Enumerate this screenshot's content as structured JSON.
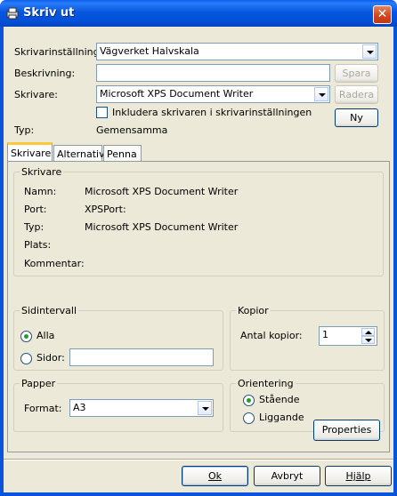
{
  "window": {
    "title": "Skriv ut",
    "close_glyph": "✕"
  },
  "top": {
    "setting_label": "Skrivarinställning:",
    "setting_value": "Vägverket Halvskala",
    "description_label": "Beskrivning:",
    "description_value": "",
    "printer_label": "Skrivare:",
    "printer_value": "Microsoft XPS Document Writer",
    "include_checkbox_label": "Inkludera skrivaren i skrivarinställningen",
    "type_label": "Typ:",
    "type_value": "Gemensamma",
    "save_button": "Spara",
    "delete_button": "Radera",
    "new_button": "Ny"
  },
  "tabs": [
    "Skrivare",
    "Alternativ",
    "Penna"
  ],
  "printer_group": {
    "title": "Skrivare",
    "rows": [
      {
        "label": "Namn:",
        "value": "Microsoft XPS Document Writer"
      },
      {
        "label": "Port:",
        "value": "XPSPort:"
      },
      {
        "label": "Typ:",
        "value": "Microsoft XPS Document Writer"
      },
      {
        "label": "Plats:",
        "value": ""
      },
      {
        "label": "Kommentar:",
        "value": ""
      }
    ]
  },
  "page_range": {
    "title": "Sidintervall",
    "all_label": "Alla",
    "pages_label": "Sidor:",
    "pages_value": ""
  },
  "copies": {
    "title": "Kopior",
    "count_label": "Antal kopior:",
    "count_value": "1"
  },
  "paper": {
    "title": "Papper",
    "format_label": "Format:",
    "format_value": "A3"
  },
  "orientation": {
    "title": "Orientering",
    "portrait_label": "Stående",
    "landscape_label": "Liggande"
  },
  "properties_button": "Properties",
  "footer": {
    "ok_button": "Ok",
    "cancel_button": "Avbryt",
    "help_button": "Hjälp"
  }
}
